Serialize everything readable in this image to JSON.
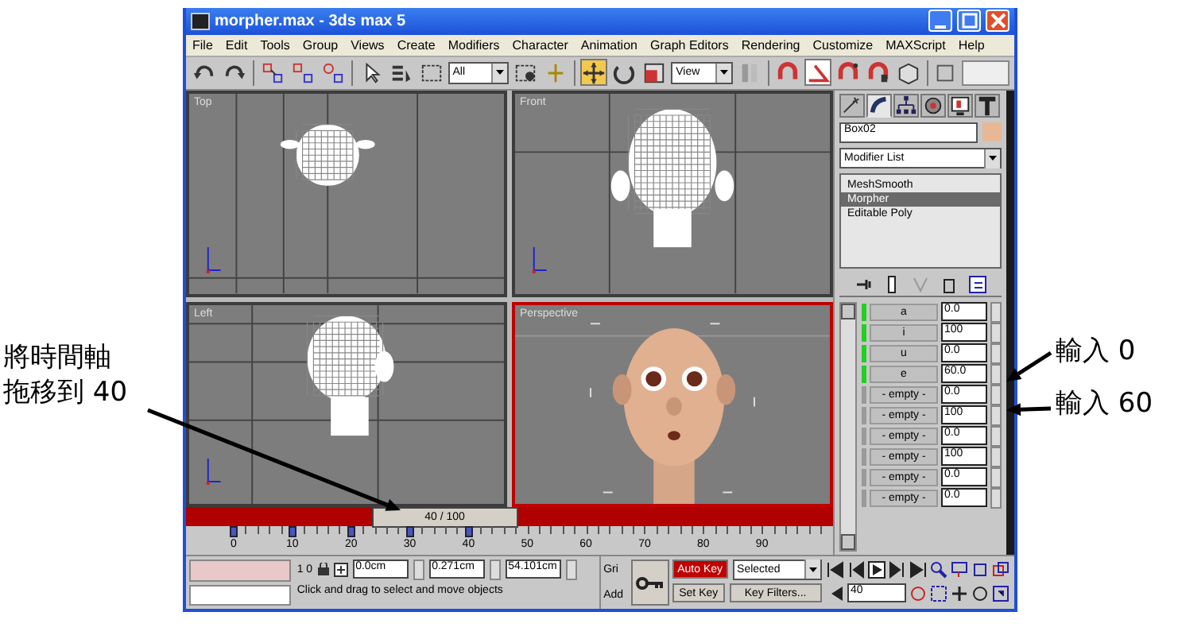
{
  "window": {
    "title": "morpher.max - 3ds max 5"
  },
  "menu": [
    "File",
    "Edit",
    "Tools",
    "Group",
    "Views",
    "Create",
    "Modifiers",
    "Character",
    "Animation",
    "Graph Editors",
    "Rendering",
    "Customize",
    "MAXScript",
    "Help"
  ],
  "toolbar": [
    {
      "kind": "button",
      "selected": false
    },
    {
      "kind": "button",
      "selected": false
    },
    {
      "kind": "sep"
    },
    {
      "kind": "button",
      "selected": false
    },
    {
      "kind": "button",
      "selected": false
    },
    {
      "kind": "button",
      "selected": false
    },
    {
      "kind": "sep"
    },
    {
      "kind": "button",
      "selected": false
    },
    {
      "kind": "button",
      "selected": false
    },
    {
      "kind": "button",
      "selected": false
    },
    {
      "kind": "dropdown",
      "value": "All"
    },
    {
      "kind": "button",
      "selected": false
    },
    {
      "kind": "button",
      "selected": false
    },
    {
      "kind": "sep"
    },
    {
      "kind": "button",
      "selected": true
    },
    {
      "kind": "button",
      "selected": false
    },
    {
      "kind": "button",
      "selected": false
    },
    {
      "kind": "dropdown",
      "value": "View"
    },
    {
      "kind": "button",
      "selected": false
    },
    {
      "kind": "sep"
    },
    {
      "kind": "button",
      "selected": false
    },
    {
      "kind": "button",
      "selected": true
    },
    {
      "kind": "button",
      "selected": false
    },
    {
      "kind": "button",
      "selected": false
    },
    {
      "kind": "button",
      "selected": false
    },
    {
      "kind": "sep"
    },
    {
      "kind": "button",
      "selected": false
    }
  ],
  "viewports": [
    {
      "label": "Top",
      "kind": "wire-top",
      "active": false
    },
    {
      "label": "Front",
      "kind": "wire-front",
      "active": false
    },
    {
      "label": "Left",
      "kind": "wire-left",
      "active": false
    },
    {
      "label": "Perspective",
      "kind": "shaded",
      "active": true
    }
  ],
  "time_slider": {
    "reading": "40 / 100",
    "level": 0.4
  },
  "ruler": [
    {
      "text": "0",
      "key": true
    },
    {
      "text": "10",
      "key": true
    },
    {
      "text": "20",
      "key": true
    },
    {
      "text": "30",
      "key": true
    },
    {
      "text": "40",
      "key": true
    },
    {
      "text": "50",
      "key": false
    },
    {
      "text": "60",
      "key": false
    },
    {
      "text": "70",
      "key": false
    },
    {
      "text": "80",
      "key": false
    },
    {
      "text": "90",
      "key": false
    }
  ],
  "command_panel": {
    "tabs": [
      {
        "selected": false
      },
      {
        "selected": true
      },
      {
        "selected": false
      },
      {
        "selected": false
      },
      {
        "selected": false
      },
      {
        "selected": false
      }
    ],
    "object_name": "Box02",
    "modifier_list": "Modifier List",
    "stack": [
      {
        "label": "MeshSmooth",
        "selected": false
      },
      {
        "label": "Morpher",
        "selected": true
      },
      {
        "label": "Editable Poly",
        "selected": false
      }
    ],
    "channels": [
      {
        "name": "a",
        "active": true,
        "value": "0.0"
      },
      {
        "name": "i",
        "active": true,
        "value": "100"
      },
      {
        "name": "u",
        "active": true,
        "value": "0.0"
      },
      {
        "name": "e",
        "active": true,
        "value": "60.0"
      },
      {
        "name": "- empty -",
        "active": false,
        "value": "0.0"
      },
      {
        "name": "- empty -",
        "active": false,
        "value": "100"
      },
      {
        "name": "- empty -",
        "active": false,
        "value": "0.0"
      },
      {
        "name": "- empty -",
        "active": false,
        "value": "100"
      },
      {
        "name": "- empty -",
        "active": false,
        "value": "0.0"
      },
      {
        "name": "- empty -",
        "active": false,
        "value": "0.0"
      }
    ]
  },
  "status": {
    "selection": "1 0",
    "x": "0.0cm",
    "y": "0.271cm",
    "z": "54.101cm",
    "grid": "Gri",
    "add": "Add",
    "prompt": "Click and drag to select and move objects",
    "auto_key": {
      "label": "Auto Key",
      "on": true
    },
    "key_mode": "Selected",
    "set_key": "Set Key",
    "key_filters": "Key Filters...",
    "frame": "40"
  },
  "callouts": [
    {
      "kind": "left",
      "lines": [
        "將時間軸",
        "拖移到 40"
      ]
    },
    {
      "kind": "right-upper",
      "lines": [
        "輸入 0"
      ]
    },
    {
      "kind": "right-lower",
      "lines": [
        "輸入 60"
      ]
    }
  ]
}
